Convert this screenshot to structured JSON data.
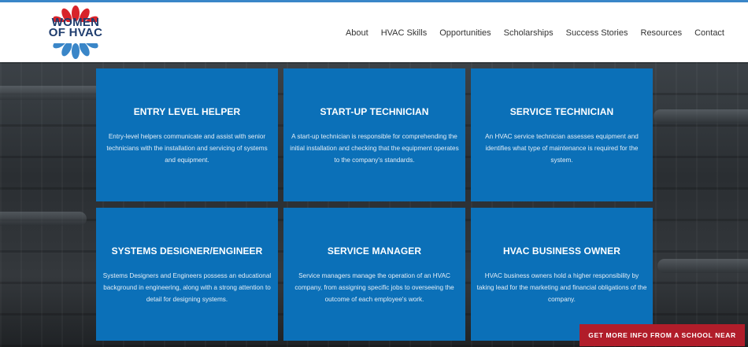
{
  "logo": {
    "text": "WOMEN OF HVAC",
    "colors": {
      "petals": "#d8232a",
      "lower_petals": "#3a86c8",
      "text": "#1f3d6e"
    }
  },
  "nav": {
    "items": [
      "About",
      "HVAC Skills",
      "Opportunities",
      "Scholarships",
      "Success Stories",
      "Resources",
      "Contact"
    ]
  },
  "cards": [
    {
      "title": "ENTRY LEVEL HELPER",
      "description": "Entry-level helpers communicate and assist with senior technicians with the installation and servicing of systems and equipment."
    },
    {
      "title": "START-UP TECHNICIAN",
      "description": "A start-up technician is responsible for comprehending the initial installation and checking that the equipment operates to the company's standards."
    },
    {
      "title": "SERVICE TECHNICIAN",
      "description": "An HVAC service technician assesses equipment and identifies what type of maintenance is required for the system."
    },
    {
      "title": "SYSTEMS DESIGNER/ENGINEER",
      "description": "Systems Designers and Engineers possess an educational background in engineering, along with a strong attention to detail for designing systems."
    },
    {
      "title": "SERVICE MANAGER",
      "description": "Service managers manage the operation of an HVAC company, from assigning specific jobs to overseeing the outcome of each employee's work."
    },
    {
      "title": "HVAC BUSINESS OWNER",
      "description": "HVAC business owners hold a higher responsibility by taking lead for the marketing and financial obligations of the company."
    }
  ],
  "cta": {
    "label": "GET MORE INFO FROM A SCHOOL NEAR YOU"
  },
  "colors": {
    "accent_bar": "#3a86c8",
    "card_bg": "#0b70b8",
    "cta_bg": "#b11d2a"
  }
}
